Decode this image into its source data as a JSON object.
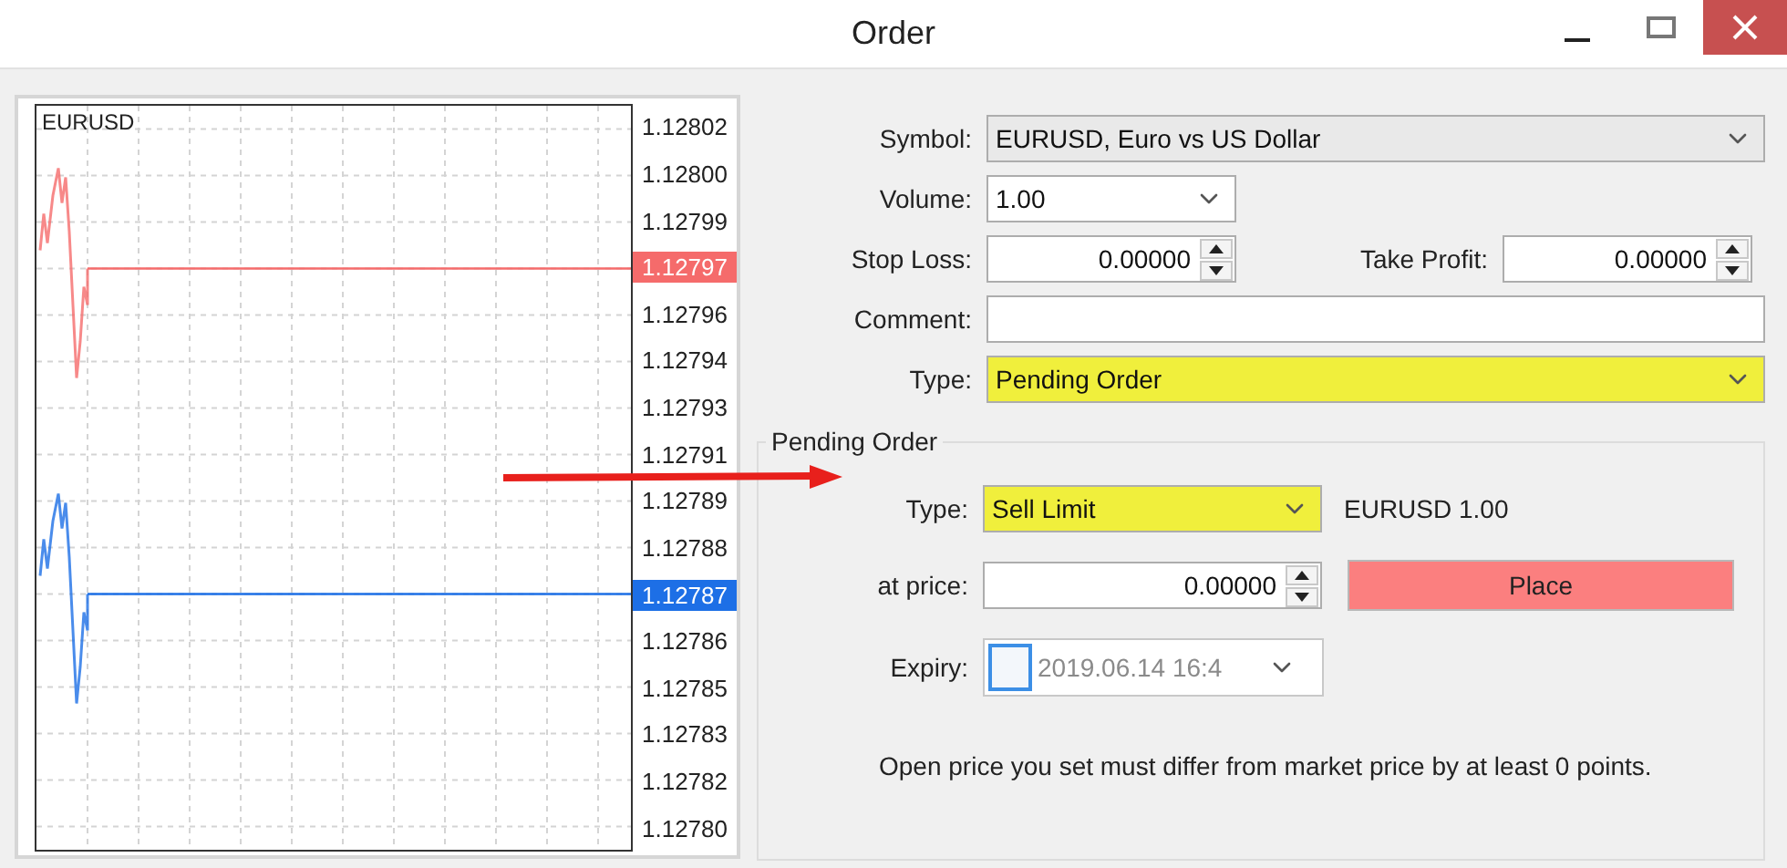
{
  "window": {
    "title": "Order"
  },
  "chart": {
    "symbol": "EURUSD",
    "axis": [
      {
        "kind": "label",
        "text": "1.12802"
      },
      {
        "kind": "label",
        "text": "1.12800"
      },
      {
        "kind": "label",
        "text": "1.12799"
      },
      {
        "kind": "bid",
        "text": "1.12797"
      },
      {
        "kind": "label",
        "text": "1.12796"
      },
      {
        "kind": "label",
        "text": "1.12794"
      },
      {
        "kind": "label",
        "text": "1.12793"
      },
      {
        "kind": "label",
        "text": "1.12791"
      },
      {
        "kind": "label",
        "text": "1.12789"
      },
      {
        "kind": "label",
        "text": "1.12788"
      },
      {
        "kind": "ask",
        "text": "1.12787"
      },
      {
        "kind": "label",
        "text": "1.12786"
      },
      {
        "kind": "label",
        "text": "1.12785"
      },
      {
        "kind": "label",
        "text": "1.12783"
      },
      {
        "kind": "label",
        "text": "1.12782"
      },
      {
        "kind": "label",
        "text": "1.12780"
      }
    ]
  },
  "form": {
    "symbol": {
      "label": "Symbol:",
      "value": "EURUSD, Euro vs US Dollar"
    },
    "volume": {
      "label": "Volume:",
      "value": "1.00"
    },
    "stop_loss": {
      "label": "Stop Loss:",
      "value": "0.00000"
    },
    "take_profit": {
      "label": "Take Profit:",
      "value": "0.00000"
    },
    "comment": {
      "label": "Comment:"
    },
    "type": {
      "label": "Type:",
      "value": "Pending Order",
      "highlighted": true
    }
  },
  "pending_order": {
    "title": "Pending Order",
    "type": {
      "label": "Type:",
      "value": "Sell Limit",
      "highlighted": true
    },
    "summary": "EURUSD 1.00",
    "price": {
      "label": "at price:",
      "value": "0.00000"
    },
    "place_button": "Place",
    "expiry": {
      "label": "Expiry:",
      "value": "2019.06.14 16:4",
      "checked": false,
      "disabled": true
    },
    "note": "Open price you set must differ from market price by at least 0 points."
  }
}
